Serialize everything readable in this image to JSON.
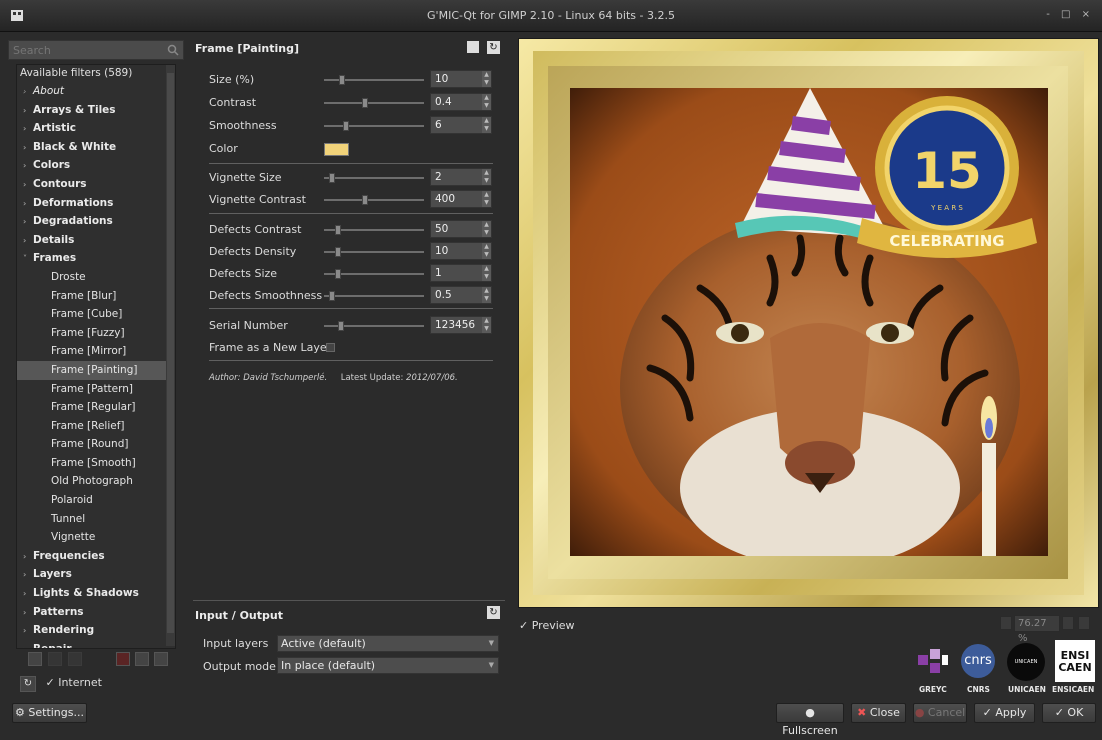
{
  "window": {
    "title": "G'MIC-Qt for GIMP 2.10 - Linux 64 bits - 3.2.5",
    "controls": "- □ ×"
  },
  "search": {
    "placeholder": "Search"
  },
  "filters": {
    "header": "Available filters (589)",
    "items": [
      {
        "label": "About",
        "kind": "italic",
        "arrow": "›"
      },
      {
        "label": "Arrays & Tiles",
        "kind": "cat",
        "arrow": "›"
      },
      {
        "label": "Artistic",
        "kind": "cat",
        "arrow": "›"
      },
      {
        "label": "Black & White",
        "kind": "cat",
        "arrow": "›"
      },
      {
        "label": "Colors",
        "kind": "cat",
        "arrow": "›"
      },
      {
        "label": "Contours",
        "kind": "cat",
        "arrow": "›"
      },
      {
        "label": "Deformations",
        "kind": "cat",
        "arrow": "›"
      },
      {
        "label": "Degradations",
        "kind": "cat",
        "arrow": "›"
      },
      {
        "label": "Details",
        "kind": "cat",
        "arrow": "›"
      },
      {
        "label": "Frames",
        "kind": "cat",
        "arrow": "˅"
      },
      {
        "label": "Droste",
        "kind": "child"
      },
      {
        "label": "Frame [Blur]",
        "kind": "child"
      },
      {
        "label": "Frame [Cube]",
        "kind": "child"
      },
      {
        "label": "Frame [Fuzzy]",
        "kind": "child"
      },
      {
        "label": "Frame [Mirror]",
        "kind": "child"
      },
      {
        "label": "Frame [Painting]",
        "kind": "child",
        "selected": true
      },
      {
        "label": "Frame [Pattern]",
        "kind": "child"
      },
      {
        "label": "Frame [Regular]",
        "kind": "child"
      },
      {
        "label": "Frame [Relief]",
        "kind": "child"
      },
      {
        "label": "Frame [Round]",
        "kind": "child"
      },
      {
        "label": "Frame [Smooth]",
        "kind": "child"
      },
      {
        "label": "Old Photograph",
        "kind": "child"
      },
      {
        "label": "Polaroid",
        "kind": "child"
      },
      {
        "label": "Tunnel",
        "kind": "child"
      },
      {
        "label": "Vignette",
        "kind": "child"
      },
      {
        "label": "Frequencies",
        "kind": "cat",
        "arrow": "›"
      },
      {
        "label": "Layers",
        "kind": "cat",
        "arrow": "›"
      },
      {
        "label": "Lights & Shadows",
        "kind": "cat",
        "arrow": "›"
      },
      {
        "label": "Patterns",
        "kind": "cat",
        "arrow": "›"
      },
      {
        "label": "Rendering",
        "kind": "cat",
        "arrow": "›"
      },
      {
        "label": "Repair",
        "kind": "cat",
        "arrow": "›"
      }
    ]
  },
  "internet": {
    "label": "Internet",
    "checked": true
  },
  "settings_button": "Settings...",
  "filter_panel": {
    "title": "Frame [Painting]",
    "params": [
      {
        "label": "Size (%)",
        "value": "10",
        "level": 0.16
      },
      {
        "label": "Contrast",
        "value": "0.4",
        "level": 0.4
      },
      {
        "label": "Smoothness",
        "value": "6",
        "level": 0.2
      },
      {
        "label": "Color",
        "type": "color",
        "color": "#f1d37a"
      },
      {
        "label": "Vignette Size",
        "value": "2",
        "level": 0.05
      },
      {
        "label": "Vignette Contrast",
        "value": "400",
        "level": 0.4
      },
      {
        "label": "Defects Contrast",
        "value": "50",
        "level": 0.12
      },
      {
        "label": "Defects Density",
        "value": "10",
        "level": 0.12
      },
      {
        "label": "Defects Size",
        "value": "1",
        "level": 0.12
      },
      {
        "label": "Defects Smoothness",
        "value": "0.5",
        "level": 0.05
      },
      {
        "label": "Serial Number",
        "value": "123456",
        "level": 0.15
      },
      {
        "label": "Frame as a New Layer",
        "type": "checkbox",
        "checked": false
      }
    ],
    "author_label": "Author:",
    "author": "David Tschumperlé.",
    "update_label": "Latest Update:",
    "update": "2012/07/06."
  },
  "io": {
    "title": "Input / Output",
    "input_label": "Input layers",
    "input_value": "Active (default)",
    "output_label": "Output mode",
    "output_value": "In place (default)"
  },
  "preview": {
    "label": "Preview",
    "checked": true,
    "zoom": "76.27 %",
    "badge_number": "15",
    "badge_years": "Y E A R S",
    "badge_ribbon": "CELEBRATING"
  },
  "logos": [
    {
      "name": "GREYC"
    },
    {
      "name": "CNRS",
      "mark": "cnrs"
    },
    {
      "name": "UNICAEN",
      "mark": "UNICAEN"
    },
    {
      "name": "ENSICAEN",
      "mark": "ENSI CAEN"
    }
  ],
  "buttons": {
    "fullscreen": "Fullscreen",
    "close": "Close",
    "cancel": "Cancel",
    "apply": "Apply",
    "ok": "OK"
  },
  "colors": {
    "frame_gold": "#e9d98a",
    "background": "#2b2b2b",
    "photo_bg": "#a8561c"
  }
}
